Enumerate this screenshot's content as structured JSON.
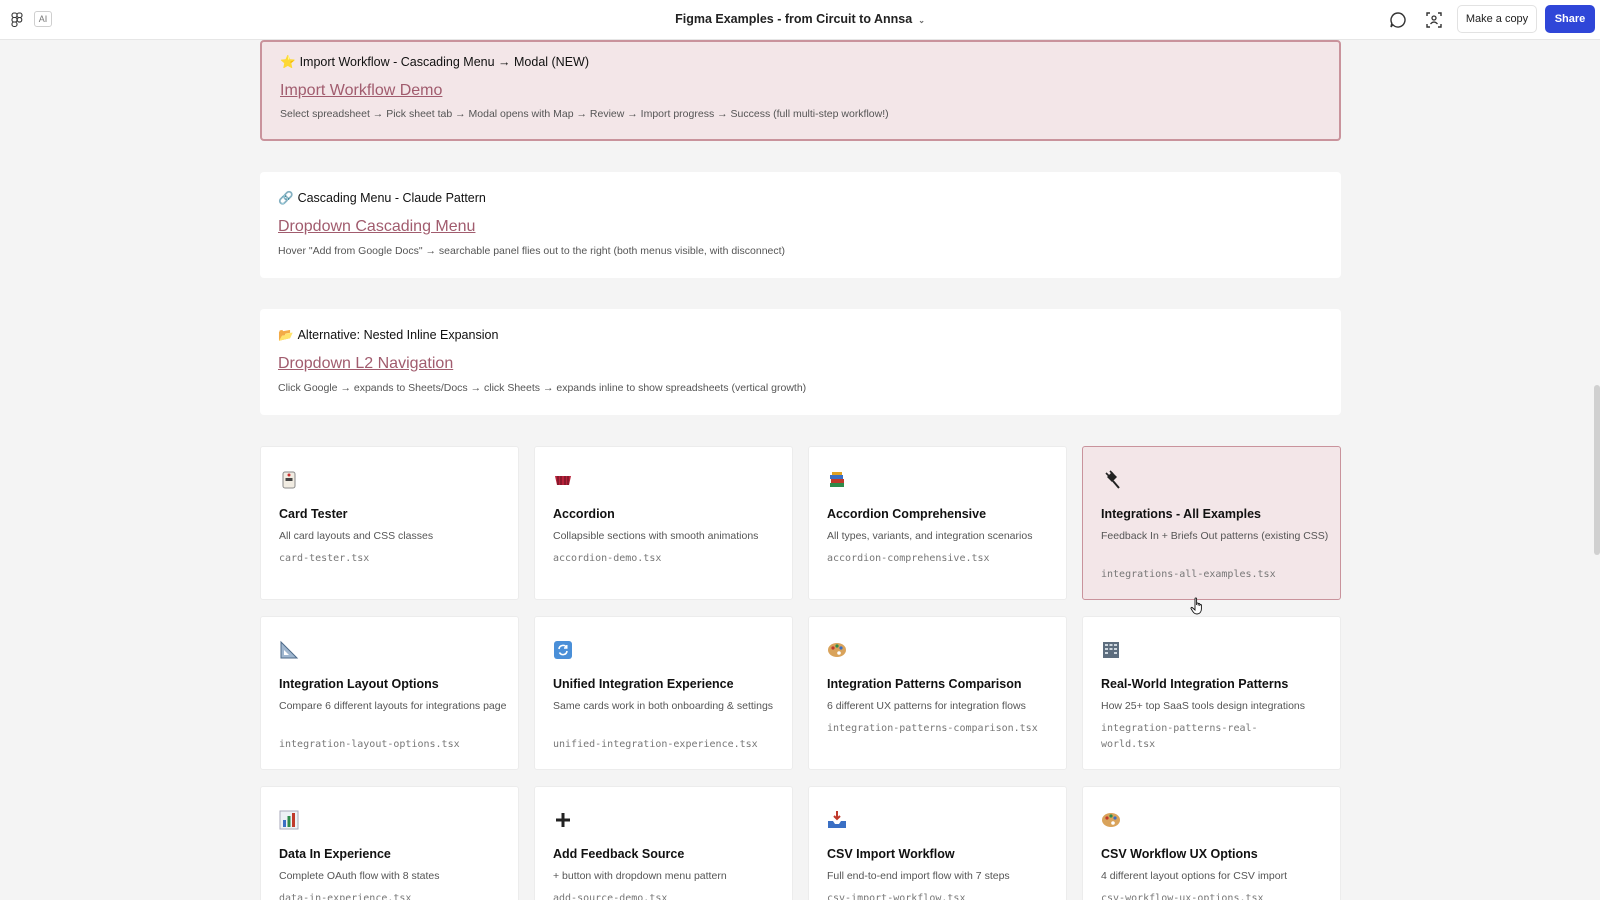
{
  "topbar": {
    "ai_label": "AI",
    "title": "Figma Examples - from Circuit to Annsa",
    "title_chevron": "⌄",
    "make_copy": "Make a copy",
    "share": "Share",
    "icons": [
      "figma-logo-icon",
      "comment-icon",
      "present-icon"
    ]
  },
  "features": [
    {
      "emoji": "⭐",
      "heading": "Import Workflow - Cascading Menu → Modal (NEW)",
      "link": "Import Workflow Demo",
      "desc": "Select spreadsheet → Pick sheet tab → Modal opens with Map → Review → Import progress → Success (full multi-step workflow!)"
    },
    {
      "emoji": "🔗",
      "heading": "Cascading Menu - Claude Pattern",
      "link": "Dropdown Cascading Menu",
      "desc": "Hover \"Add from Google Docs\" → searchable panel flies out to the right (both menus visible, with disconnect)"
    },
    {
      "emoji": "📂",
      "heading": "Alternative: Nested Inline Expansion",
      "link": "Dropdown L2 Navigation",
      "desc": "Click Google → expands to Sheets/Docs → click Sheets → expands inline to show spreadsheets (vertical growth)"
    }
  ],
  "cards": [
    {
      "icon": "card-icon",
      "title": "Card Tester",
      "desc": "All card layouts and CSS classes",
      "file": "card-tester.tsx"
    },
    {
      "icon": "accordion-icon",
      "title": "Accordion",
      "desc": "Collapsible sections with smooth animations",
      "file": "accordion-demo.tsx"
    },
    {
      "icon": "books-icon",
      "title": "Accordion Comprehensive",
      "desc": "All types, variants, and integration scenarios",
      "file": "accordion-comprehensive.tsx"
    },
    {
      "icon": "plug-icon",
      "title": "Integrations - All Examples",
      "desc": "Feedback In + Briefs Out patterns (existing CSS)",
      "file": "integrations-all-examples.tsx"
    },
    {
      "icon": "triangle-ruler-icon",
      "title": "Integration Layout Options",
      "desc": "Compare 6 different layouts for integrations page",
      "file": "integration-layout-options.tsx"
    },
    {
      "icon": "sync-icon",
      "title": "Unified Integration Experience",
      "desc": "Same cards work in both onboarding & settings",
      "file": "unified-integration-experience.tsx"
    },
    {
      "icon": "palette-icon",
      "title": "Integration Patterns Comparison",
      "desc": "6 different UX patterns for integration flows",
      "file": "integration-patterns-comparison.tsx"
    },
    {
      "icon": "building-icon",
      "title": "Real-World Integration Patterns",
      "desc": "How 25+ top SaaS tools design integrations",
      "file": "integration-patterns-real-world.tsx"
    },
    {
      "icon": "bar-chart-icon",
      "title": "Data In Experience",
      "desc": "Complete OAuth flow with 8 states",
      "file": "data-in-experience.tsx"
    },
    {
      "icon": "plus-icon",
      "title": "Add Feedback Source",
      "desc": "+ button with dropdown menu pattern",
      "file": "add-source-demo.tsx"
    },
    {
      "icon": "inbox-tray-icon",
      "title": "CSV Import Workflow",
      "desc": "Full end-to-end import flow with 7 steps",
      "file": "csv-import-workflow.tsx"
    },
    {
      "icon": "palette-icon",
      "title": "CSV Workflow UX Options",
      "desc": "4 different layout options for CSV import",
      "file": "csv-workflow-ux-options.tsx"
    }
  ],
  "colors": {
    "accent_link": "#a15c6e",
    "highlight_bg": "#f3e6e8",
    "highlight_border": "#c9939c",
    "share_button": "#2f46d8"
  }
}
